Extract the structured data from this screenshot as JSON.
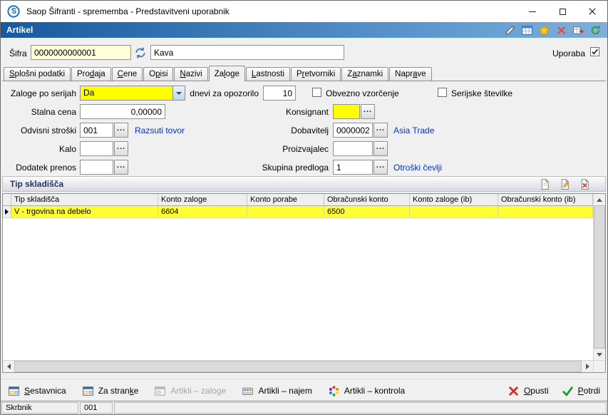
{
  "window": {
    "title": "Saop Šifranti - sprememba - Predstavitveni uporabnik"
  },
  "header": {
    "title": "Artikel",
    "icons": [
      "edit-pencil-icon",
      "tables-icon",
      "favorites-star-icon",
      "close-red-icon",
      "export-grid-icon",
      "refresh-green-icon"
    ]
  },
  "record": {
    "code_label": "Šifra",
    "code_value": "0000000000001",
    "name_value": "Kava",
    "usage_label": "Uporaba",
    "usage_checked": true
  },
  "tabs": [
    {
      "id": "splosni-podatki",
      "pre": "",
      "key": "S",
      "post": "plošni podatki",
      "active": false
    },
    {
      "id": "prodaja",
      "pre": "Pro",
      "key": "d",
      "post": "aja",
      "active": false
    },
    {
      "id": "cene",
      "pre": "",
      "key": "C",
      "post": "ene",
      "active": false
    },
    {
      "id": "opisi",
      "pre": "O",
      "key": "p",
      "post": "isi",
      "active": false
    },
    {
      "id": "nazivi",
      "pre": "",
      "key": "N",
      "post": "azivi",
      "active": false
    },
    {
      "id": "zaloge",
      "pre": "Za",
      "key": "l",
      "post": "oge",
      "active": true
    },
    {
      "id": "lastnosti",
      "pre": "",
      "key": "L",
      "post": "astnosti",
      "active": false
    },
    {
      "id": "pretvorniki",
      "pre": "P",
      "key": "r",
      "post": "etvorniki",
      "active": false
    },
    {
      "id": "zaznamki",
      "pre": "Z",
      "key": "a",
      "post": "znamki",
      "active": false
    },
    {
      "id": "naprave",
      "pre": "Napr",
      "key": "a",
      "post": "ve",
      "active": false
    }
  ],
  "fields": {
    "zaloge_po_serijah": {
      "label": "Zaloge po serijah",
      "value": "Da"
    },
    "dnevi_za_opozorilo": {
      "label": "dnevi za opozorilo",
      "value": "10"
    },
    "obvezno_vzorcenje": {
      "label": "Obvezno vzorčenje",
      "checked": false
    },
    "serijske_stevilke": {
      "label": "Serijske številke",
      "checked": false
    },
    "stalna_cena": {
      "label": "Stalna cena",
      "value": "0,00000"
    },
    "konsignant": {
      "label": "Konsignant",
      "value": ""
    },
    "odvisni_stroski": {
      "label": "Odvisni stroški",
      "value": "001",
      "link": "Razsuti tovor"
    },
    "dobavitelj": {
      "label": "Dobavitelj",
      "value": "0000002",
      "link": "Asia Trade"
    },
    "kalo": {
      "label": "Kalo",
      "value": ""
    },
    "proizvajalec": {
      "label": "Proizvajalec",
      "value": ""
    },
    "dodatek_prenos": {
      "label": "Dodatek prenos",
      "value": ""
    },
    "skupina_predloga": {
      "label": "Skupina predloga",
      "value": "1",
      "link": "Otroški čevlji"
    }
  },
  "grid": {
    "title": "Tip skladišča",
    "tools": [
      "insert-record-icon",
      "edit-record-icon",
      "delete-record-icon"
    ],
    "columns": [
      "Tip skladišča",
      "Konto zaloge",
      "Konto porabe",
      "Obračunski konto",
      "Konto zaloge (ib)",
      "Obračunski konto (ib)"
    ],
    "rows": [
      [
        "V - trgovina na debelo",
        "6604",
        "",
        "6500",
        "",
        ""
      ]
    ]
  },
  "footer": {
    "left_buttons": [
      {
        "id": "sestavnica",
        "pre": "",
        "key": "S",
        "post": "estavnica",
        "icon": "window-icon",
        "disabled": false
      },
      {
        "id": "za-stranke",
        "pre": "Za stran",
        "key": "k",
        "post": "e",
        "icon": "window-icon",
        "disabled": false
      },
      {
        "id": "artikli-zaloge",
        "pre": "Artikli – zaloge",
        "key": "",
        "post": "",
        "icon": "window-gray-icon",
        "disabled": true
      },
      {
        "id": "artikli-najem",
        "pre": "Artikli – najem",
        "key": "",
        "post": "",
        "icon": "rental-icon",
        "disabled": false
      },
      {
        "id": "artikli-kontrola",
        "pre": "Artikli – kontrola",
        "key": "",
        "post": "",
        "icon": "control-wheel-icon",
        "disabled": false
      }
    ],
    "right_buttons": [
      {
        "id": "opusti",
        "pre": "",
        "key": "O",
        "post": "pusti",
        "icon": "cancel-x-icon",
        "disabled": false
      },
      {
        "id": "potrdi",
        "pre": "",
        "key": "P",
        "post": "otrdi",
        "icon": "confirm-check-icon",
        "disabled": false
      }
    ]
  },
  "statusbar": {
    "user": "Skrbnik",
    "operator": "001"
  },
  "ui": {
    "ellipsis": "..."
  },
  "colors": {
    "header_blue_left": "#17599F",
    "header_blue_right": "#5C97CE",
    "highlight_yellow": "#FFFF00",
    "field_cream": "#FFFFDC",
    "link_blue": "#0033CC",
    "row_yellow": "#FFFF33",
    "confirm_green": "#169E16",
    "cancel_red": "#D42B2B"
  }
}
